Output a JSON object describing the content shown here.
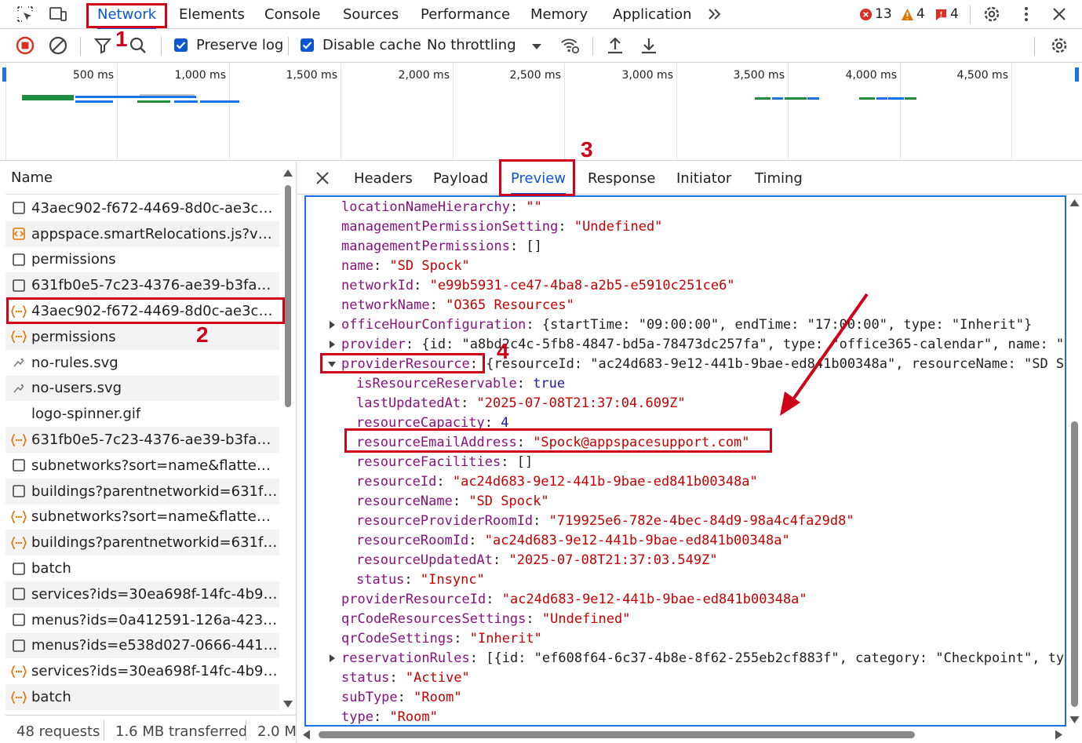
{
  "top_tabs": [
    "Network",
    "Elements",
    "Console",
    "Sources",
    "Performance",
    "Memory",
    "Application"
  ],
  "counters": {
    "errors": "13",
    "warnings": "4",
    "issues": "4"
  },
  "toolbar": {
    "preserve_log": "Preserve log",
    "disable_cache": "Disable cache",
    "throttling": "No throttling"
  },
  "overview_ticks": [
    "500 ms",
    "1,000 ms",
    "1,500 ms",
    "2,000 ms",
    "2,500 ms",
    "3,000 ms",
    "3,500 ms",
    "4,000 ms",
    "4,500 ms"
  ],
  "request_list": {
    "header": "Name",
    "rows": [
      {
        "name": "43aec902-f672-4469-8d0c-ae3c23f...",
        "icon": "document-icon"
      },
      {
        "name": "appspace.smartRelocations.js?v=20...",
        "icon": "script-icon"
      },
      {
        "name": "permissions",
        "icon": "document-icon"
      },
      {
        "name": "631fb0e5-7c23-4376-ae39-b3fa472...",
        "icon": "document-icon"
      },
      {
        "name": "43aec902-f672-4469-8d0c-ae3c23f...",
        "icon": "json-icon"
      },
      {
        "name": "permissions",
        "icon": "json-icon"
      },
      {
        "name": "no-rules.svg",
        "icon": "image-icon"
      },
      {
        "name": "no-users.svg",
        "icon": "image-icon"
      },
      {
        "name": "logo-spinner.gif",
        "icon": "blank-icon"
      },
      {
        "name": "631fb0e5-7c23-4376-ae39-b3fa472...",
        "icon": "json-icon"
      },
      {
        "name": "subnetworks?sort=name&flatten=t...",
        "icon": "document-icon"
      },
      {
        "name": "buildings?parentnetworkid=631fb0...",
        "icon": "document-icon"
      },
      {
        "name": "subnetworks?sort=name&flatten=t...",
        "icon": "json-icon"
      },
      {
        "name": "buildings?parentnetworkid=631fb0...",
        "icon": "json-icon"
      },
      {
        "name": "batch",
        "icon": "document-icon"
      },
      {
        "name": "services?ids=30ea698f-14fc-4b90-a...",
        "icon": "document-icon"
      },
      {
        "name": "menus?ids=0a412591-126a-4234-8...",
        "icon": "document-icon"
      },
      {
        "name": "menus?ids=e538d027-0666-4413-...",
        "icon": "document-icon"
      },
      {
        "name": "services?ids=30ea698f-14fc-4b90-a...",
        "icon": "json-icon"
      },
      {
        "name": "batch",
        "icon": "json-icon"
      }
    ],
    "status": {
      "requests": "48 requests",
      "transferred": "1.6 MB transferred",
      "resources": "2.0 M"
    }
  },
  "detail_tabs": [
    "Headers",
    "Payload",
    "Preview",
    "Response",
    "Initiator",
    "Timing"
  ],
  "preview_lines": [
    {
      "indent": 0,
      "toggle": "",
      "key": "locationNameHierarchy",
      "value": "\"\"",
      "type": "s"
    },
    {
      "indent": 0,
      "toggle": "",
      "key": "managementPermissionSetting",
      "value": "\"Undefined\"",
      "type": "s"
    },
    {
      "indent": 0,
      "toggle": "",
      "key": "managementPermissions",
      "value": "[]",
      "type": "p"
    },
    {
      "indent": 0,
      "toggle": "",
      "key": "name",
      "value": "\"SD Spock\"",
      "type": "s"
    },
    {
      "indent": 0,
      "toggle": "",
      "key": "networkId",
      "value": "\"e99b5931-ce47-4ba8-a2b5-e5910c251ce6\"",
      "type": "s"
    },
    {
      "indent": 0,
      "toggle": "",
      "key": "networkName",
      "value": "\"O365 Resources\"",
      "type": "s"
    },
    {
      "indent": 0,
      "toggle": "right",
      "key": "officeHourConfiguration",
      "value": "{startTime: \"09:00:00\", endTime: \"17:00:00\", type: \"Inherit\"}",
      "type": "p"
    },
    {
      "indent": 0,
      "toggle": "right",
      "key": "provider",
      "value": "{id: \"a8bd2c4c-5fb8-4847-bd5a-78473dc257fa\", type: \"office365-calendar\", name: \"",
      "type": "p"
    },
    {
      "indent": 0,
      "toggle": "down",
      "key": "providerResource",
      "value": "{resourceId: \"ac24d683-9e12-441b-9bae-ed841b00348a\", resourceName: \"SD S",
      "type": "p"
    },
    {
      "indent": 1,
      "toggle": "",
      "key": "isResourceReservable",
      "value": "true",
      "type": "n"
    },
    {
      "indent": 1,
      "toggle": "",
      "key": "lastUpdatedAt",
      "value": "\"2025-07-08T21:37:04.609Z\"",
      "type": "s"
    },
    {
      "indent": 1,
      "toggle": "",
      "key": "resourceCapacity",
      "value": "4",
      "type": "n"
    },
    {
      "indent": 1,
      "toggle": "",
      "key": "resourceEmailAddress",
      "value": "\"Spock@appspacesupport.com\"",
      "type": "s"
    },
    {
      "indent": 1,
      "toggle": "",
      "key": "resourceFacilities",
      "value": "[]",
      "type": "p"
    },
    {
      "indent": 1,
      "toggle": "",
      "key": "resourceId",
      "value": "\"ac24d683-9e12-441b-9bae-ed841b00348a\"",
      "type": "s"
    },
    {
      "indent": 1,
      "toggle": "",
      "key": "resourceName",
      "value": "\"SD Spock\"",
      "type": "s"
    },
    {
      "indent": 1,
      "toggle": "",
      "key": "resourceProviderRoomId",
      "value": "\"719925e6-782e-4bec-84d9-98a4c4fa29d8\"",
      "type": "s"
    },
    {
      "indent": 1,
      "toggle": "",
      "key": "resourceRoomId",
      "value": "\"ac24d683-9e12-441b-9bae-ed841b00348a\"",
      "type": "s"
    },
    {
      "indent": 1,
      "toggle": "",
      "key": "resourceUpdatedAt",
      "value": "\"2025-07-08T21:37:03.549Z\"",
      "type": "s"
    },
    {
      "indent": 1,
      "toggle": "",
      "key": "status",
      "value": "\"Insync\"",
      "type": "s"
    },
    {
      "indent": 0,
      "toggle": "",
      "key": "providerResourceId",
      "value": "\"ac24d683-9e12-441b-9bae-ed841b00348a\"",
      "type": "s"
    },
    {
      "indent": 0,
      "toggle": "",
      "key": "qrCodeResourcesSettings",
      "value": "\"Undefined\"",
      "type": "s"
    },
    {
      "indent": 0,
      "toggle": "",
      "key": "qrCodeSettings",
      "value": "\"Inherit\"",
      "type": "s"
    },
    {
      "indent": 0,
      "toggle": "right",
      "key": "reservationRules",
      "value": "[{id: \"ef608f64-6c37-4b8e-8f62-255eb2cf883f\", category: \"Checkpoint\", ty",
      "type": "p"
    },
    {
      "indent": 0,
      "toggle": "",
      "key": "status",
      "value": "\"Active\"",
      "type": "s"
    },
    {
      "indent": 0,
      "toggle": "",
      "key": "subType",
      "value": "\"Room\"",
      "type": "s"
    },
    {
      "indent": 0,
      "toggle": "",
      "key": "type",
      "value": "\"Room\"",
      "type": "s"
    }
  ],
  "annotations": [
    "1",
    "2",
    "3",
    "4"
  ],
  "colors": {
    "accent": "#0b57d0",
    "annotation": "#d0021b",
    "key": "#881280",
    "string": "#c80000",
    "number": "#1a1aa6"
  }
}
